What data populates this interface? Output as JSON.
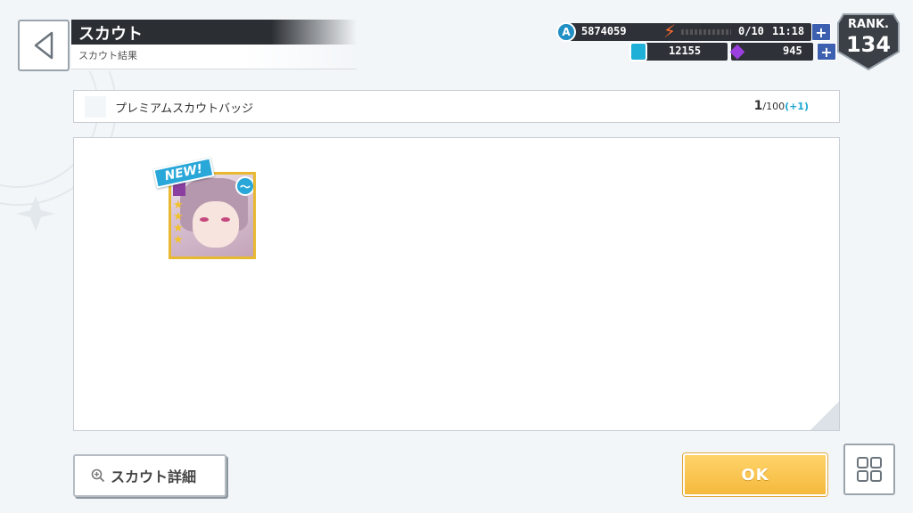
{
  "header": {
    "title": "スカウト",
    "subtitle": "スカウト結果"
  },
  "currency": {
    "money": "5874059",
    "stamina": "0/10",
    "timer": "11:18",
    "gems": "12155",
    "premium": "945",
    "plus_label": "+"
  },
  "rank": {
    "label": "RANK.",
    "value": "134"
  },
  "item": {
    "name": "プレミアムスカウトバッジ",
    "count": "1",
    "total": "/100",
    "gain": "(+1)"
  },
  "results": {
    "new_label": "NEW!",
    "stars": 4
  },
  "buttons": {
    "detail": "スカウト詳細",
    "ok": "OK"
  },
  "colors": {
    "ok_button": "#f5b93c",
    "accent": "#29a7d8",
    "card_border": "#e8b930"
  }
}
